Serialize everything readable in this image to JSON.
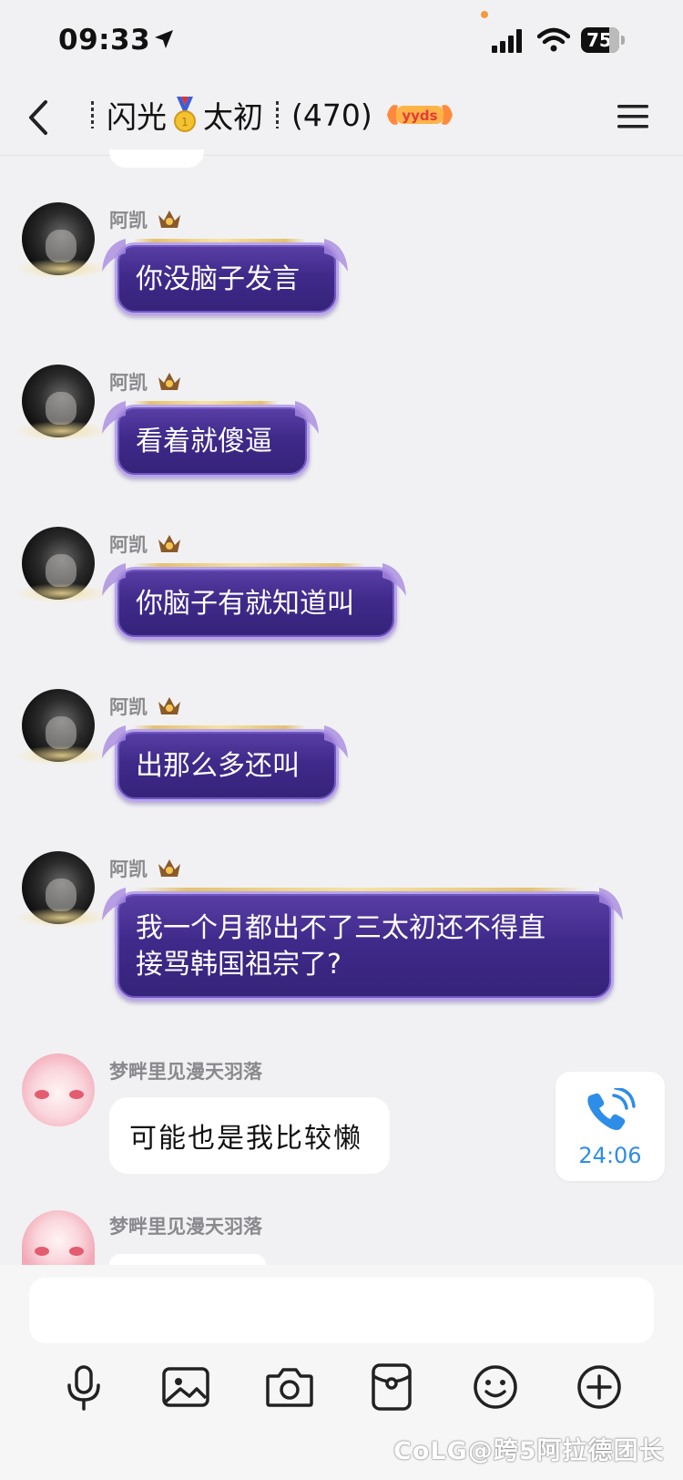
{
  "status_bar": {
    "time": "09:33",
    "battery": "75"
  },
  "header": {
    "title_prefix": "闪光",
    "title_mid": "太初",
    "member_count": "(470)",
    "badge_text": "yyds"
  },
  "messages": [
    {
      "sender": "阿凯",
      "text": "你没脑子发言"
    },
    {
      "sender": "阿凯",
      "text": "看着就傻逼"
    },
    {
      "sender": "阿凯",
      "text": "你脑子有就知道叫"
    },
    {
      "sender": "阿凯",
      "text": "出那么多还叫"
    },
    {
      "sender": "阿凯",
      "text_line1": "我一个月都出不了三太初还不得直",
      "text_line2": "接骂韩国祖宗了?"
    },
    {
      "sender": "梦畔里见漫天羽落",
      "text": "可能也是我比较懒"
    },
    {
      "sender": "梦畔里见漫天羽落"
    }
  ],
  "call_card": {
    "duration": "24:06"
  },
  "toolbar": {
    "icons": [
      "mic-icon",
      "image-icon",
      "camera-icon",
      "red-packet-icon",
      "emoji-icon",
      "plus-icon"
    ]
  },
  "watermark": "CoLG@跨5阿拉德团长"
}
